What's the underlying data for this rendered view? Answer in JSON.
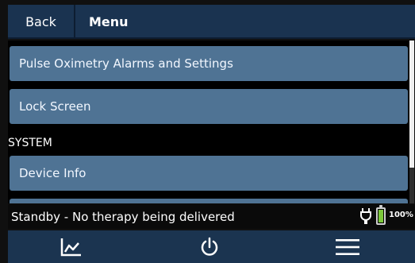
{
  "header": {
    "back_label": "Back",
    "title": "Menu"
  },
  "menu": {
    "items": [
      {
        "label": "Pulse Oximetry Alarms and Settings"
      },
      {
        "label": "Lock Screen"
      }
    ],
    "sections": [
      {
        "label": "SYSTEM",
        "items": [
          {
            "label": "Device Info"
          }
        ]
      }
    ]
  },
  "status": {
    "text": "Standby - No therapy being delivered",
    "battery_percent_label": "100%",
    "battery_level": 1.0,
    "battery_color": "#7cc83b",
    "power_icon": "plug-icon"
  },
  "bottom_nav": {
    "buttons": [
      {
        "icon": "chart-icon"
      },
      {
        "icon": "power-icon"
      },
      {
        "icon": "menu-icon"
      }
    ]
  },
  "colors": {
    "header_bg": "#1a3350",
    "menu_item_bg": "#4f7394",
    "nav_bg": "#1b3450",
    "background": "#000000"
  }
}
